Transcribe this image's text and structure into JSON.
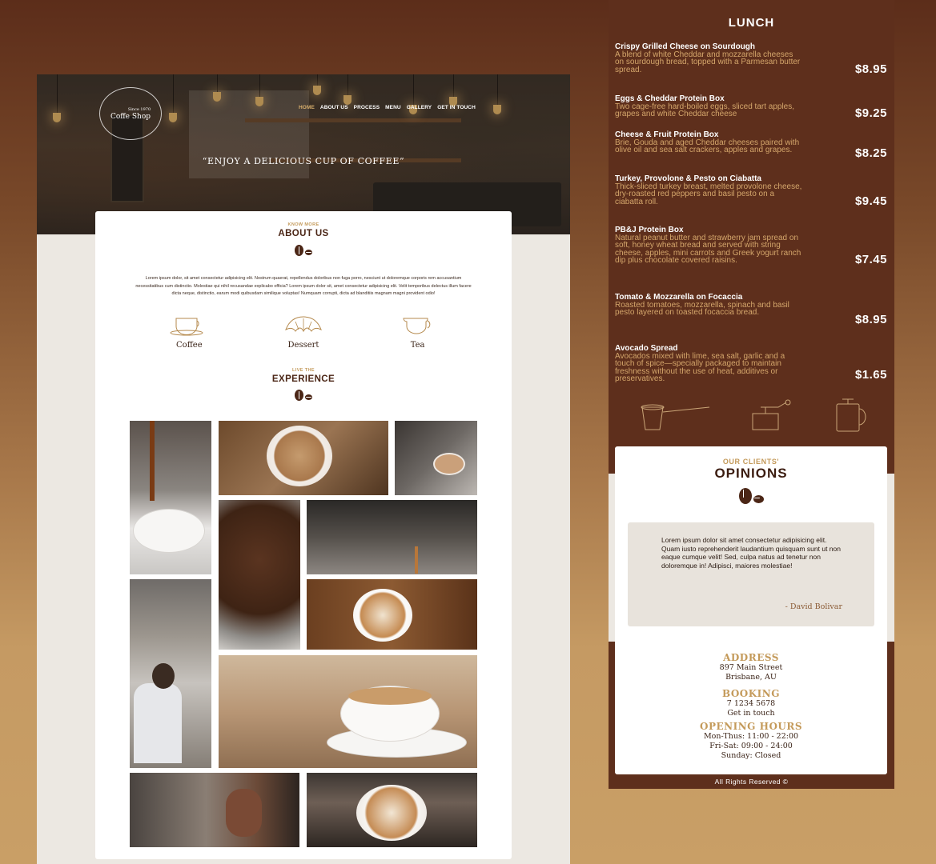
{
  "site": {
    "logo_since": "Since 1970",
    "logo_name": "Coffe Shop",
    "nav": [
      "HOME",
      "ABOUT US",
      "PROCESS",
      "MENU",
      "GALLERY",
      "GET IN TOUCH"
    ],
    "tagline": "“ENJOY A DELICIOUS CUP OF COFFEE”"
  },
  "about": {
    "kicker": "KNOW MORE",
    "title": "ABOUT US",
    "body": "Lorem ipsum dolor, sit amet consectetur adipisicing elit. Nostrum quaerat, repellendus doloribus non fuga porro, nesciunt ut doloremque corporis rem accusantium necessitatibus cum distinctio. Molestiae qui nihil recusandae explicabo officia? Lorem ipsum dolor sit, amet consectetur adipisicing elit. Velit temporibus delectus illum facere dicta neque, distinctio, earum modi quibusdam similique voluptas! Numquam corrupti, dicta ad blanditiis magnam magni provident odio!",
    "features": [
      {
        "label": "Coffee",
        "icon": "coffee-cup-icon"
      },
      {
        "label": "Dessert",
        "icon": "croissant-icon"
      },
      {
        "label": "Tea",
        "icon": "tea-cup-icon"
      }
    ]
  },
  "experience": {
    "kicker": "LIVE THE",
    "title": "EXPERIENCE"
  },
  "lunch": {
    "title": "LUNCH",
    "items": [
      {
        "name": "Crispy Grilled Cheese on Sourdough",
        "desc": "A blend of white Cheddar and mozzarella cheeses on sourdough bread, topped with a Parmesan butter spread.",
        "price": "$8.95"
      },
      {
        "name": "Eggs & Cheddar Protein Box",
        "desc": "Two cage-free hard-boiled eggs, sliced tart apples, grapes and white Cheddar cheese",
        "price": "$9.25"
      },
      {
        "name": "Cheese & Fruit Protein Box",
        "desc": "Brie, Gouda and aged Cheddar cheeses paired with olive oil and sea salt crackers, apples and grapes.",
        "price": "$8.25"
      },
      {
        "name": "Turkey, Provolone & Pesto on Ciabatta",
        "desc": "Thick-sliced turkey breast, melted provolone cheese, dry-roasted red peppers and basil pesto on a ciabatta roll.",
        "price": "$9.45"
      },
      {
        "name": "PB&J Protein Box",
        "desc": "Natural peanut butter and strawberry jam spread on soft, honey wheat bread and served with string cheese, apples, mini carrots and Greek yogurt ranch dip plus chocolate covered raisins.",
        "price": "$7.45"
      },
      {
        "name": "Tomato & Mozzarella on Focaccia",
        "desc": "Roasted tomatoes, mozzarella, spinach and basil pesto layered on toasted focaccia bread.",
        "price": "$8.95"
      },
      {
        "name": "Avocado Spread",
        "desc": "Avocados mixed with lime, sea salt, garlic and a touch of spice—specially packaged to maintain freshness without the use of heat, additives or preservatives.",
        "price": "$1.65"
      }
    ]
  },
  "opinions": {
    "kicker": "OUR CLIENTS'",
    "title": "OPINIONS",
    "quote": "Lorem ipsum dolor sit amet consectetur adipisicing elit. Quam iusto reprehenderit laudantium quisquam sunt ut non eaque cumque velit! Sed, culpa natus ad tenetur non doloremque in! Adipisci, maiores molestiae!",
    "author": "- David Bolivar"
  },
  "contact": {
    "address_title": "ADDRESS",
    "address_line1": "897 Main Street",
    "address_line2": "Brisbane, AU",
    "booking_title": "BOOKING",
    "phone": "7 1234 5678",
    "get_in_touch": "Get in touch",
    "hours_title": "OPENING HOURS",
    "hours1": "Mon-Thus: 11:00 - 22:00",
    "hours2": "Fri-Sat: 09:00 - 24:00",
    "hours3": "Sunday: Closed"
  },
  "footer": "All Rights Reserved ©",
  "colors": {
    "brown_dark": "#5e2f1c",
    "gold": "#c49a5a",
    "accent_nav": "#d6ad6b",
    "card_bg": "#ffffff",
    "page_light": "#ece8e2"
  }
}
